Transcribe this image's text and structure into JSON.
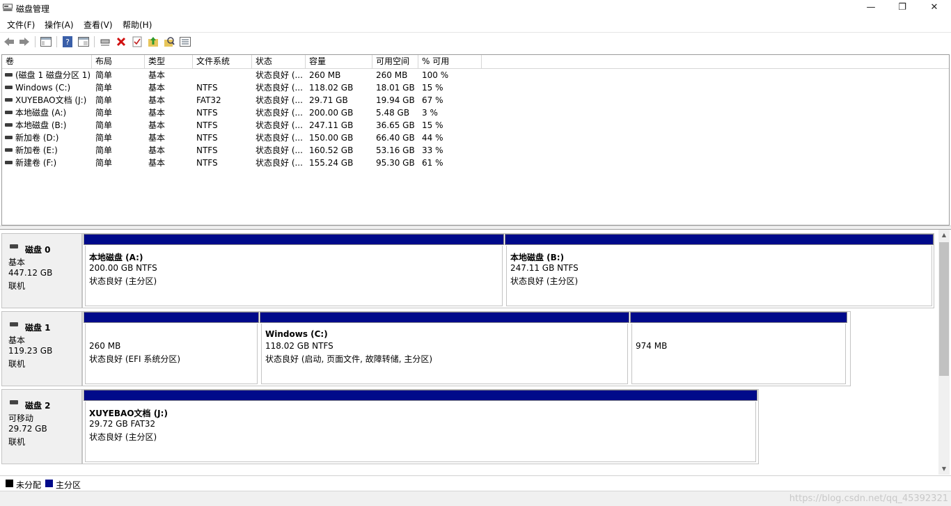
{
  "window": {
    "title": "磁盘管理",
    "controls": {
      "minimize": "—",
      "maximize": "❐",
      "close": "✕"
    }
  },
  "menu": [
    {
      "label": "文件(F)"
    },
    {
      "label": "操作(A)"
    },
    {
      "label": "查看(V)"
    },
    {
      "label": "帮助(H)"
    }
  ],
  "toolbar": {
    "buttons": [
      "back-icon",
      "forward-icon",
      "console-tree-icon",
      "help-icon",
      "properties-icon",
      "connect-icon",
      "delete-icon",
      "check-icon",
      "up-folder-icon",
      "search-icon",
      "list-icon"
    ]
  },
  "volume_table": {
    "columns": [
      "卷",
      "布局",
      "类型",
      "文件系统",
      "状态",
      "容量",
      "可用空间",
      "% 可用"
    ],
    "rows": [
      [
        "(磁盘 1 磁盘分区 1)",
        "简单",
        "基本",
        "",
        "状态良好 (...",
        "260 MB",
        "260 MB",
        "100 %"
      ],
      [
        "Windows (C:)",
        "简单",
        "基本",
        "NTFS",
        "状态良好 (...",
        "118.02 GB",
        "18.01 GB",
        "15 %"
      ],
      [
        "XUYEBAO文档 (J:)",
        "简单",
        "基本",
        "FAT32",
        "状态良好 (...",
        "29.71 GB",
        "19.94 GB",
        "67 %"
      ],
      [
        "本地磁盘 (A:)",
        "简单",
        "基本",
        "NTFS",
        "状态良好 (...",
        "200.00 GB",
        "5.48 GB",
        "3 %"
      ],
      [
        "本地磁盘 (B:)",
        "简单",
        "基本",
        "NTFS",
        "状态良好 (...",
        "247.11 GB",
        "36.65 GB",
        "15 %"
      ],
      [
        "新加卷 (D:)",
        "简单",
        "基本",
        "NTFS",
        "状态良好 (...",
        "150.00 GB",
        "66.40 GB",
        "44 %"
      ],
      [
        "新加卷 (E:)",
        "简单",
        "基本",
        "NTFS",
        "状态良好 (...",
        "160.52 GB",
        "53.16 GB",
        "33 %"
      ],
      [
        "新建卷 (F:)",
        "简单",
        "基本",
        "NTFS",
        "状态良好 (...",
        "155.24 GB",
        "95.30 GB",
        "61 %"
      ]
    ]
  },
  "disks": [
    {
      "name": "磁盘 0",
      "type": "基本",
      "size": "447.12 GB",
      "status": "联机",
      "partitions": [
        {
          "title": "本地磁盘  (A:)",
          "size": "200.00 GB NTFS",
          "status": "状态良好 (主分区)"
        },
        {
          "title": "本地磁盘  (B:)",
          "size": "247.11 GB NTFS",
          "status": "状态良好 (主分区)"
        }
      ]
    },
    {
      "name": "磁盘 1",
      "type": "基本",
      "size": "119.23 GB",
      "status": "联机",
      "partitions": [
        {
          "title": "",
          "size": "260 MB",
          "status": "状态良好 (EFI 系统分区)"
        },
        {
          "title": "Windows  (C:)",
          "size": "118.02 GB NTFS",
          "status": "状态良好 (启动, 页面文件, 故障转储, 主分区)"
        },
        {
          "title": "",
          "size": "974 MB",
          "status": ""
        }
      ]
    },
    {
      "name": "磁盘 2",
      "type": "可移动",
      "size": "29.72 GB",
      "status": "联机",
      "partitions": [
        {
          "title": "XUYEBAO文档  (J:)",
          "size": "29.72 GB FAT32",
          "status": "状态良好 (主分区)"
        }
      ]
    }
  ],
  "legend": [
    {
      "label": "未分配",
      "color": "#000000"
    },
    {
      "label": "主分区",
      "color": "#000a8a"
    }
  ],
  "watermark": "https://blog.csdn.net/qq_45392321"
}
